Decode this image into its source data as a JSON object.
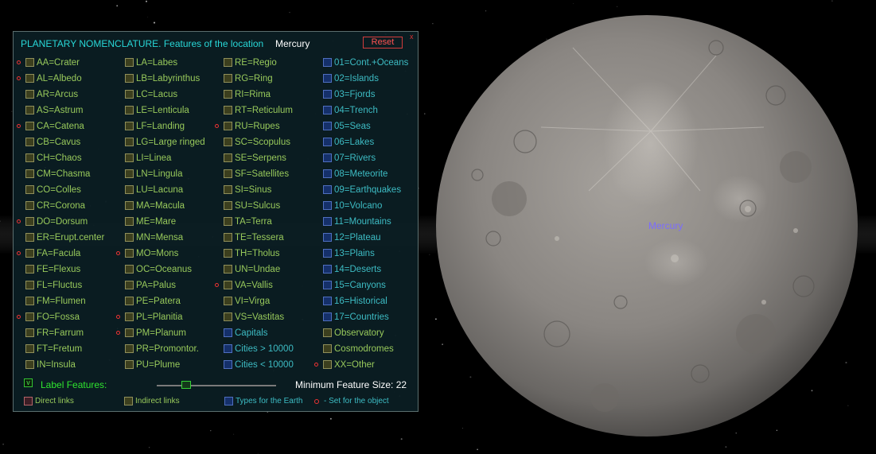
{
  "panel": {
    "title": "PLANETARY NOMENCLATURE. Features of the location",
    "location": "Mercury",
    "reset_label": "Reset",
    "close_glyph": "x"
  },
  "features": {
    "col1": [
      {
        "label": "AA=Crater",
        "set": true
      },
      {
        "label": "AL=Albedo",
        "set": true
      },
      {
        "label": "AR=Arcus",
        "set": false
      },
      {
        "label": "AS=Astrum",
        "set": false
      },
      {
        "label": "CA=Catena",
        "set": true
      },
      {
        "label": "CB=Cavus",
        "set": false
      },
      {
        "label": "CH=Chaos",
        "set": false
      },
      {
        "label": "CM=Chasma",
        "set": false
      },
      {
        "label": "CO=Colles",
        "set": false
      },
      {
        "label": "CR=Corona",
        "set": false
      },
      {
        "label": "DO=Dorsum",
        "set": true
      },
      {
        "label": "ER=Erupt.center",
        "set": false
      },
      {
        "label": "FA=Facula",
        "set": true
      },
      {
        "label": "FE=Flexus",
        "set": false
      },
      {
        "label": "FL=Fluctus",
        "set": false
      },
      {
        "label": "FM=Flumen",
        "set": false
      },
      {
        "label": "FO=Fossa",
        "set": true
      },
      {
        "label": "FR=Farrum",
        "set": false
      },
      {
        "label": "FT=Fretum",
        "set": false
      },
      {
        "label": "IN=Insula",
        "set": false
      }
    ],
    "col2": [
      {
        "label": "LA=Labes",
        "set": false
      },
      {
        "label": "LB=Labyrinthus",
        "set": false
      },
      {
        "label": "LC=Lacus",
        "set": false
      },
      {
        "label": "LE=Lenticula",
        "set": false
      },
      {
        "label": "LF=Landing",
        "set": false
      },
      {
        "label": "LG=Large ringed",
        "set": false
      },
      {
        "label": "LI=Linea",
        "set": false
      },
      {
        "label": "LN=Lingula",
        "set": false
      },
      {
        "label": "LU=Lacuna",
        "set": false
      },
      {
        "label": "MA=Macula",
        "set": false
      },
      {
        "label": "ME=Mare",
        "set": false
      },
      {
        "label": "MN=Mensa",
        "set": false
      },
      {
        "label": "MO=Mons",
        "set": true
      },
      {
        "label": "OC=Oceanus",
        "set": false
      },
      {
        "label": "PA=Palus",
        "set": false
      },
      {
        "label": "PE=Patera",
        "set": false
      },
      {
        "label": "PL=Planitia",
        "set": true
      },
      {
        "label": "PM=Planum",
        "set": true
      },
      {
        "label": "PR=Promontor.",
        "set": false
      },
      {
        "label": "PU=Plume",
        "set": false
      }
    ],
    "col3": [
      {
        "label": "RE=Regio",
        "set": false,
        "type": "olive"
      },
      {
        "label": "RG=Ring",
        "set": false,
        "type": "olive"
      },
      {
        "label": "RI=Rima",
        "set": false,
        "type": "olive"
      },
      {
        "label": "RT=Reticulum",
        "set": false,
        "type": "olive"
      },
      {
        "label": "RU=Rupes",
        "set": true,
        "type": "olive"
      },
      {
        "label": "SC=Scopulus",
        "set": false,
        "type": "olive"
      },
      {
        "label": "SE=Serpens",
        "set": false,
        "type": "olive"
      },
      {
        "label": "SF=Satellites",
        "set": false,
        "type": "olive"
      },
      {
        "label": "SI=Sinus",
        "set": false,
        "type": "olive"
      },
      {
        "label": "SU=Sulcus",
        "set": false,
        "type": "olive"
      },
      {
        "label": "TA=Terra",
        "set": false,
        "type": "olive"
      },
      {
        "label": "TE=Tessera",
        "set": false,
        "type": "olive"
      },
      {
        "label": "TH=Tholus",
        "set": false,
        "type": "olive"
      },
      {
        "label": "UN=Undae",
        "set": false,
        "type": "olive"
      },
      {
        "label": "VA=Vallis",
        "set": true,
        "type": "olive"
      },
      {
        "label": "VI=Virga",
        "set": false,
        "type": "olive"
      },
      {
        "label": "VS=Vastitas",
        "set": false,
        "type": "olive"
      },
      {
        "label": "Capitals",
        "set": false,
        "type": "blue"
      },
      {
        "label": "Cities > 10000",
        "set": false,
        "type": "blue"
      },
      {
        "label": "Cities < 10000",
        "set": false,
        "type": "blue"
      }
    ],
    "col4": [
      {
        "label": "01=Cont.+Oceans",
        "set": false,
        "type": "blue"
      },
      {
        "label": "02=Islands",
        "set": false,
        "type": "blue"
      },
      {
        "label": "03=Fjords",
        "set": false,
        "type": "blue"
      },
      {
        "label": "04=Trench",
        "set": false,
        "type": "blue"
      },
      {
        "label": "05=Seas",
        "set": false,
        "type": "blue"
      },
      {
        "label": "06=Lakes",
        "set": false,
        "type": "blue"
      },
      {
        "label": "07=Rivers",
        "set": false,
        "type": "blue"
      },
      {
        "label": "08=Meteorite",
        "set": false,
        "type": "blue"
      },
      {
        "label": "09=Earthquakes",
        "set": false,
        "type": "blue"
      },
      {
        "label": "10=Volcano",
        "set": false,
        "type": "blue"
      },
      {
        "label": "11=Mountains",
        "set": false,
        "type": "blue"
      },
      {
        "label": "12=Plateau",
        "set": false,
        "type": "blue"
      },
      {
        "label": "13=Plains",
        "set": false,
        "type": "blue"
      },
      {
        "label": "14=Deserts",
        "set": false,
        "type": "blue"
      },
      {
        "label": "15=Canyons",
        "set": false,
        "type": "blue"
      },
      {
        "label": "16=Historical",
        "set": false,
        "type": "blue"
      },
      {
        "label": "17=Countries",
        "set": false,
        "type": "blue"
      },
      {
        "label": "Observatory",
        "set": false,
        "type": "olive"
      },
      {
        "label": "Cosmodromes",
        "set": false,
        "type": "olive"
      },
      {
        "label": "XX=Other",
        "set": true,
        "type": "olive"
      }
    ]
  },
  "label_features": {
    "label": "Label Features:",
    "checked": true,
    "check_glyph": "v"
  },
  "min_feature_size": {
    "label": "Minimum Feature Size:",
    "value": "22",
    "slider_level_percent": 25
  },
  "legend": {
    "direct": "Direct links",
    "indirect": "Indirect links",
    "earth": "Types for the Earth",
    "set": "- Set for the object"
  },
  "planet": {
    "name": "Mercury"
  },
  "colors": {
    "title": "#28d7d7",
    "label_green": "#98c95b",
    "label_cyan": "#3dbcc4",
    "marker_red": "#ee3333",
    "reset_red": "#ff5252",
    "planet_label": "#7b6cff"
  }
}
